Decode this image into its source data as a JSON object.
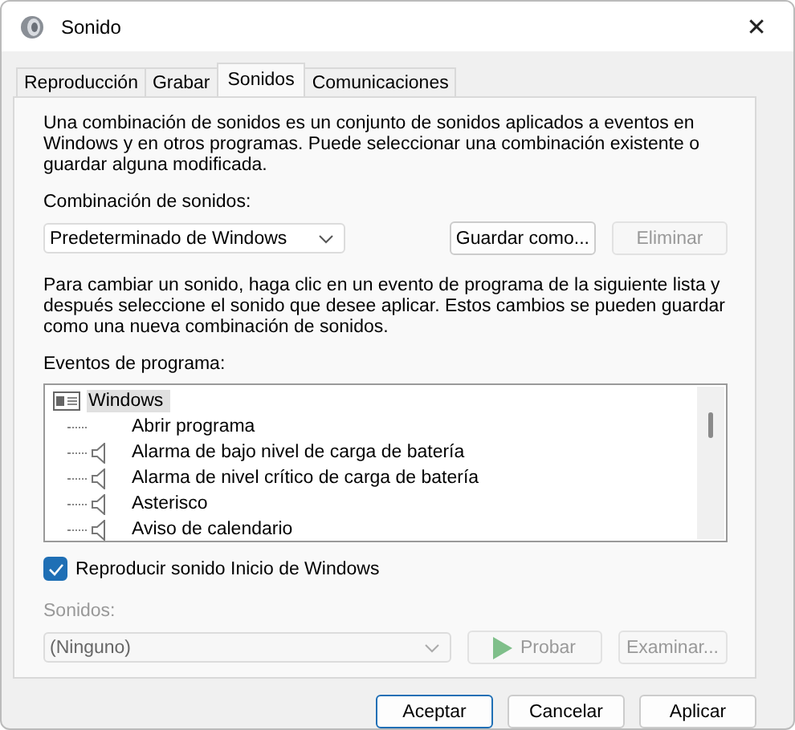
{
  "window": {
    "title": "Sonido",
    "close": "✕"
  },
  "tabs": [
    {
      "label": "Reproducción",
      "selected": false
    },
    {
      "label": "Grabar",
      "selected": false
    },
    {
      "label": "Sonidos",
      "selected": true
    },
    {
      "label": "Comunicaciones",
      "selected": false
    }
  ],
  "intro": "Una combinación de sonidos es un conjunto de sonidos aplicados a eventos en Windows y en otros programas. Puede seleccionar una combinación existente o guardar alguna modificada.",
  "scheme": {
    "label": "Combinación de sonidos:",
    "value": "Predeterminado de Windows",
    "disabled": false
  },
  "scheme_buttons": [
    {
      "label": "Guardar como...",
      "disabled": false
    },
    {
      "label": "Eliminar",
      "disabled": true
    }
  ],
  "help": "Para cambiar un sonido, haga clic en un evento de programa de la siguiente lista y después seleccione el sonido que desee aplicar. Estos cambios se pueden guardar como una nueva combinación de sonidos.",
  "events_label": "Eventos de programa:",
  "events": [
    {
      "label": "Windows",
      "selected": true,
      "children": [
        {
          "label": "Abrir programa",
          "has_sound": false,
          "selected": false
        },
        {
          "label": "Alarma de bajo nivel de carga de batería",
          "has_sound": true,
          "selected": false
        },
        {
          "label": "Alarma de nivel crítico de carga de batería",
          "has_sound": true,
          "selected": false
        },
        {
          "label": "Asterisco",
          "has_sound": true,
          "selected": false
        },
        {
          "label": "Aviso de calendario",
          "has_sound": true,
          "selected": false
        }
      ]
    }
  ],
  "startup": {
    "label": "Reproducir sonido Inicio de Windows",
    "checked": true
  },
  "sound": {
    "label": "Sonidos:",
    "value": "(Ninguno)",
    "disabled": true
  },
  "sound_buttons": [
    {
      "kind": "play",
      "label": "Probar",
      "disabled": true
    },
    {
      "kind": "plain",
      "label": "Examinar...",
      "disabled": true
    }
  ],
  "footer_buttons": [
    {
      "label": "Aceptar",
      "default": true
    },
    {
      "label": "Cancelar",
      "default": false
    },
    {
      "label": "Aplicar",
      "default": false
    }
  ]
}
